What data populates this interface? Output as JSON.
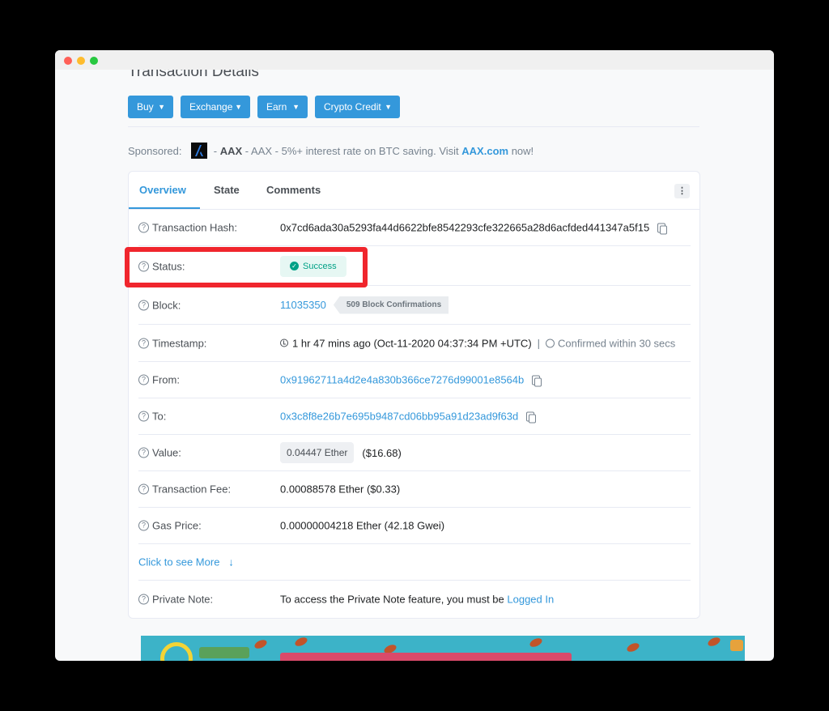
{
  "window": {
    "controls": [
      "close",
      "minimize",
      "zoom"
    ]
  },
  "page": {
    "title": "Transaction Details"
  },
  "toolbar": {
    "buttons": [
      {
        "label": "Buy"
      },
      {
        "label": "Exchange"
      },
      {
        "label": "Earn"
      },
      {
        "label": "Crypto Credit"
      }
    ],
    "chevron_icon": "chevron-down-icon"
  },
  "sponsored": {
    "prefix": "Sponsored:",
    "dash1": "-",
    "brand": "AAX",
    "text": "- AAX - 5%+ interest rate on BTC saving. Visit",
    "link": "AAX.com",
    "suffix": "now!"
  },
  "tabs": [
    {
      "label": "Overview",
      "active": true
    },
    {
      "label": "State",
      "active": false
    },
    {
      "label": "Comments",
      "active": false
    }
  ],
  "more_menu": "⋮",
  "details": {
    "hash": {
      "label": "Transaction Hash:",
      "value": "0x7cd6ada30a5293fa44d6622bfe8542293cfe322665a28d6acfded441347a5f15"
    },
    "status": {
      "label": "Status:",
      "value": "Success",
      "color": "#00a186"
    },
    "block": {
      "label": "Block:",
      "number": "11035350",
      "confirmations": "509 Block Confirmations"
    },
    "timestamp": {
      "label": "Timestamp:",
      "value": "1 hr 47 mins ago (Oct-11-2020 04:37:34 PM +UTC)",
      "separator": "|",
      "confirmed": "Confirmed within 30 secs"
    },
    "from": {
      "label": "From:",
      "value": "0x91962711a4d2e4a830b366ce7276d99001e8564b"
    },
    "to": {
      "label": "To:",
      "value": "0x3c8f8e26b7e695b9487cd06bb95a91d23ad9f63d"
    },
    "value": {
      "label": "Value:",
      "amount": "0.04447 Ether",
      "usd": "($16.68)"
    },
    "fee": {
      "label": "Transaction Fee:",
      "value": "0.00088578 Ether ($0.33)"
    },
    "gas": {
      "label": "Gas Price:",
      "value": "0.00000004218 Ether (42.18 Gwei)"
    },
    "more": {
      "label": "Click to see More",
      "arrow": "↓"
    },
    "note": {
      "label": "Private Note:",
      "text": "To access the Private Note feature, you must be",
      "link": "Logged In"
    }
  },
  "colors": {
    "accent": "#3498db",
    "highlight": "#f0262d",
    "success": "#00a186"
  }
}
